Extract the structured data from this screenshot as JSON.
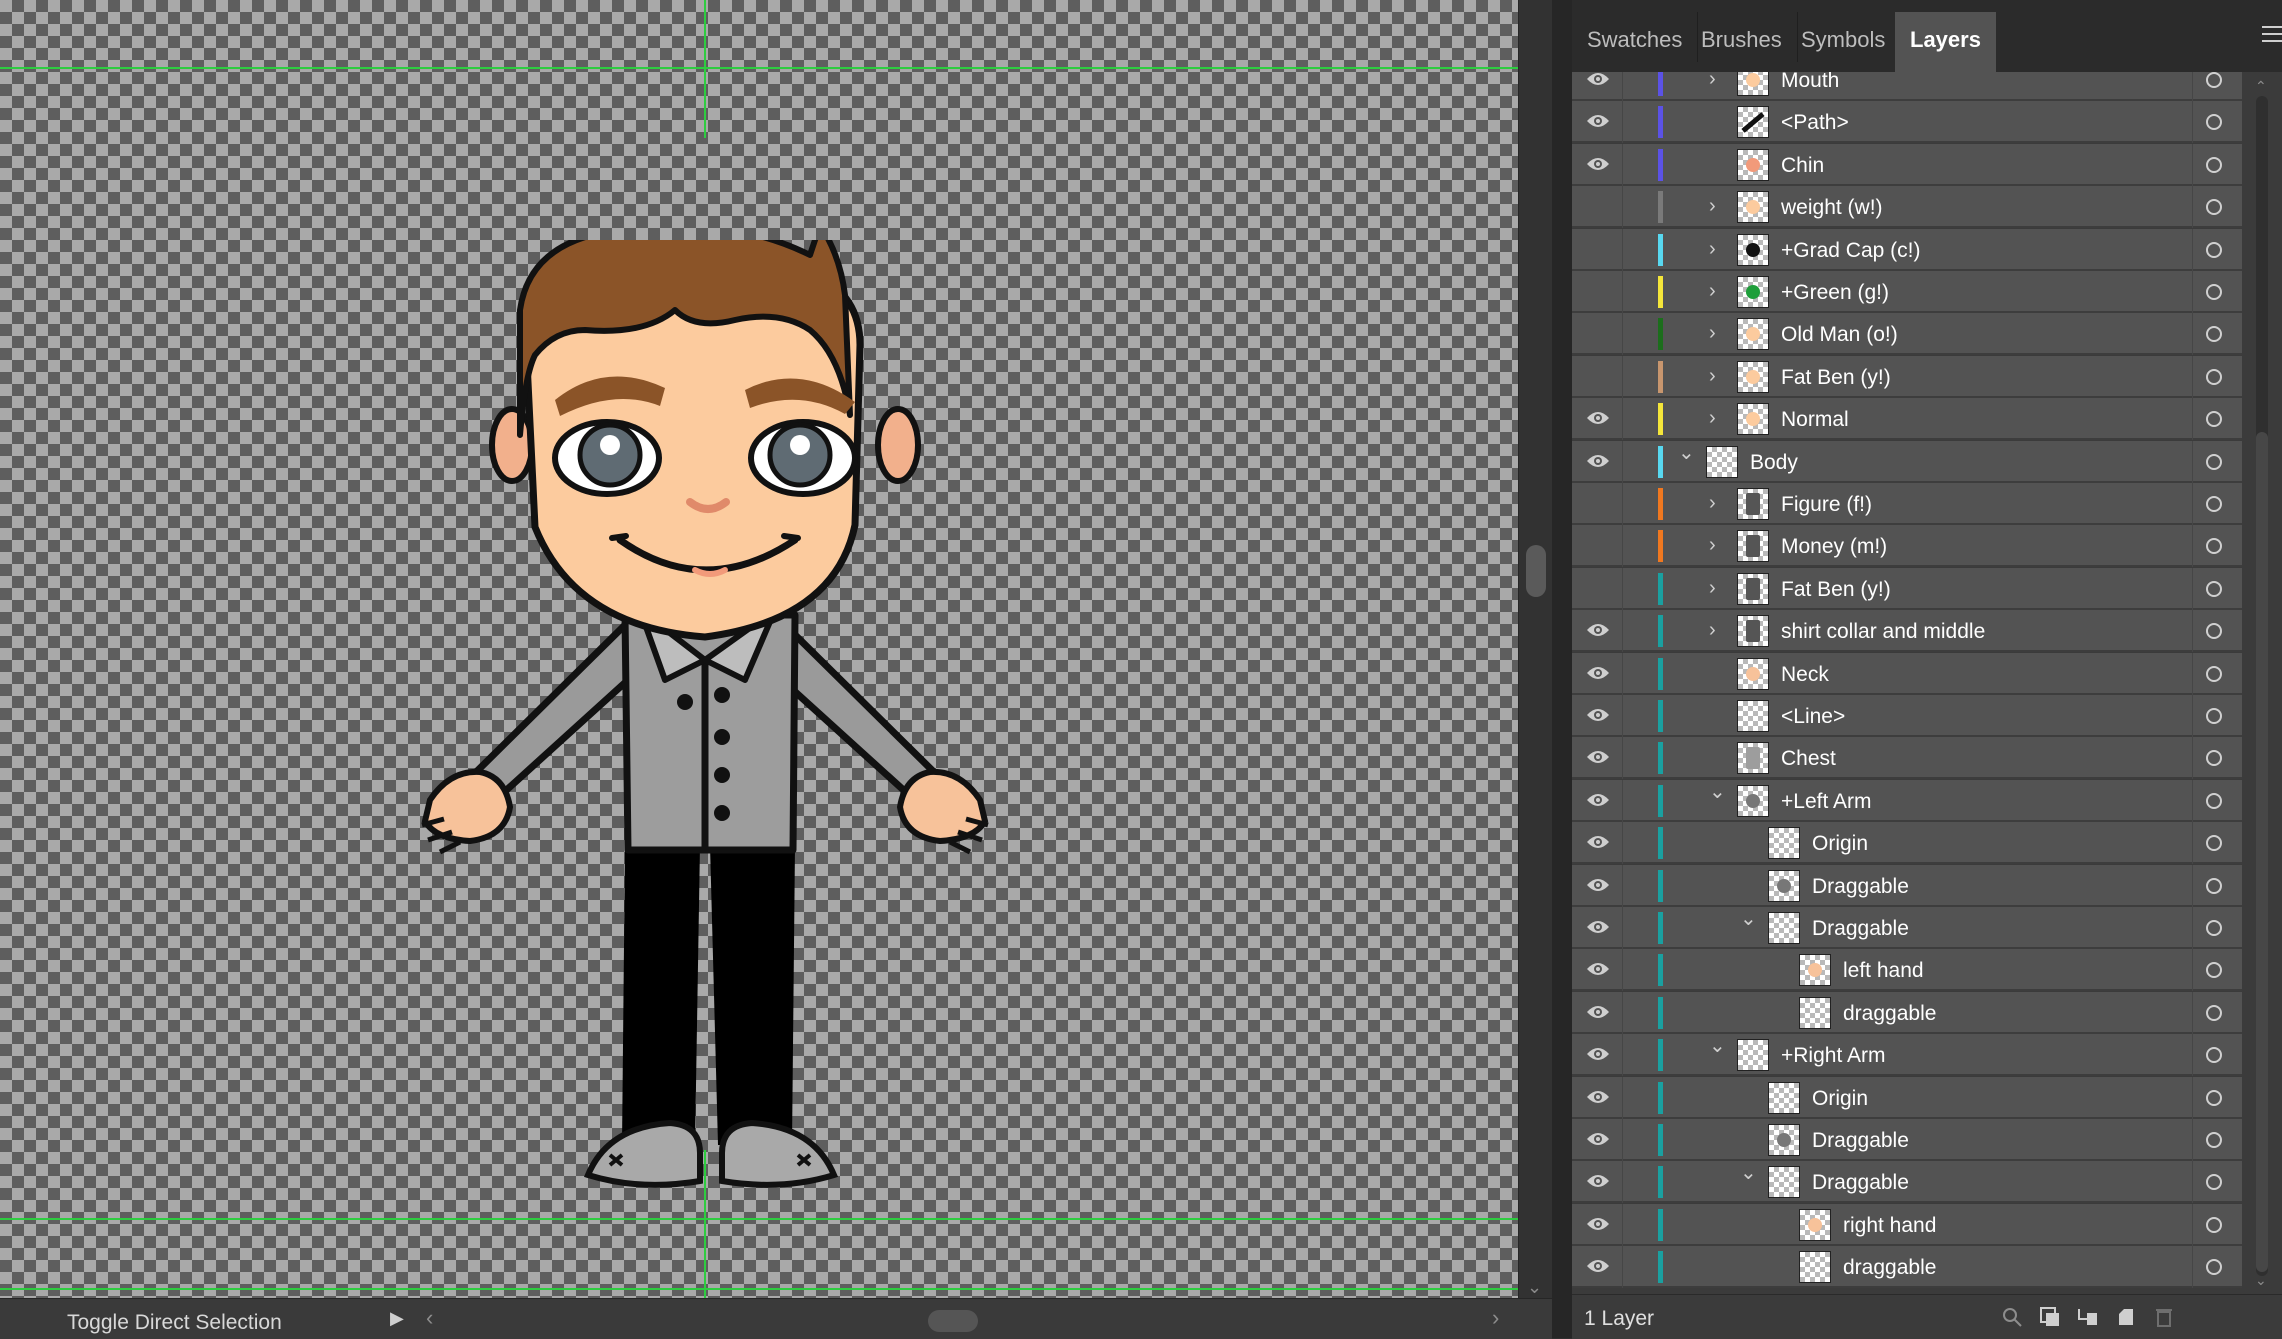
{
  "status_bar": {
    "text": "Toggle Direct Selection"
  },
  "panel": {
    "tabs": [
      {
        "label": "Swatches",
        "active": false
      },
      {
        "label": "Brushes",
        "active": false
      },
      {
        "label": "Symbols",
        "active": false
      },
      {
        "label": "Layers",
        "active": true
      }
    ],
    "footer": {
      "layer_count": "1 Layer"
    },
    "rows": [
      {
        "label": "Mouth",
        "visible": true,
        "color": "#5b52e6",
        "arrow": "right",
        "thumb": "face"
      },
      {
        "label": "<Path>",
        "visible": true,
        "color": "#5b52e6",
        "arrow": "none",
        "thumb": "path"
      },
      {
        "label": "Chin",
        "visible": true,
        "color": "#5b52e6",
        "arrow": "none",
        "thumb": "chin"
      },
      {
        "label": "weight (w!)",
        "visible": false,
        "color": "#7a7a7a",
        "arrow": "right",
        "thumb": "face"
      },
      {
        "label": "+Grad Cap (c!)",
        "visible": false,
        "color": "#58d8f0",
        "arrow": "right",
        "thumb": "cap"
      },
      {
        "label": "+Green (g!)",
        "visible": false,
        "color": "#f5e63a",
        "arrow": "right",
        "thumb": "green"
      },
      {
        "label": "Old Man (o!)",
        "visible": false,
        "color": "#1c6e1c",
        "arrow": "right",
        "thumb": "face"
      },
      {
        "label": "Fat Ben (y!)",
        "visible": false,
        "color": "#c8966e",
        "arrow": "right",
        "thumb": "face"
      },
      {
        "label": "Normal",
        "visible": true,
        "color": "#f5e63a",
        "arrow": "right",
        "thumb": "face"
      },
      {
        "label": "Body",
        "visible": true,
        "color": "#58d8f0",
        "arrow": "down",
        "thumb": "checker"
      },
      {
        "label": "Figure (f!)",
        "visible": false,
        "color": "#f07820",
        "arrow": "right",
        "thumb": "figure"
      },
      {
        "label": "Money (m!)",
        "visible": false,
        "color": "#f07820",
        "arrow": "right",
        "thumb": "figure"
      },
      {
        "label": "Fat Ben (y!)",
        "visible": false,
        "color": "#1aa0a0",
        "arrow": "right",
        "thumb": "figure"
      },
      {
        "label": "shirt collar and middle",
        "visible": true,
        "color": "#1aa0a0",
        "arrow": "right",
        "thumb": "figure"
      },
      {
        "label": "Neck",
        "visible": true,
        "color": "#1aa0a0",
        "arrow": "none",
        "thumb": "neck"
      },
      {
        "label": "<Line>",
        "visible": true,
        "color": "#1aa0a0",
        "arrow": "none",
        "thumb": "checker"
      },
      {
        "label": "Chest",
        "visible": true,
        "color": "#1aa0a0",
        "arrow": "none",
        "thumb": "chest"
      },
      {
        "label": "+Left Arm",
        "visible": true,
        "color": "#1aa0a0",
        "arrow": "down",
        "thumb": "arm"
      },
      {
        "label": "Origin",
        "visible": true,
        "color": "#1aa0a0",
        "arrow": "none",
        "thumb": "checker"
      },
      {
        "label": "Draggable",
        "visible": true,
        "color": "#1aa0a0",
        "arrow": "none",
        "thumb": "arm"
      },
      {
        "label": "Draggable",
        "visible": true,
        "color": "#1aa0a0",
        "arrow": "down",
        "thumb": "checker"
      },
      {
        "label": "left hand",
        "visible": true,
        "color": "#1aa0a0",
        "arrow": "none",
        "thumb": "hand"
      },
      {
        "label": "draggable",
        "visible": true,
        "color": "#1aa0a0",
        "arrow": "none",
        "thumb": "checker"
      },
      {
        "label": "+Right Arm",
        "visible": true,
        "color": "#1aa0a0",
        "arrow": "down",
        "thumb": "checker"
      },
      {
        "label": "Origin",
        "visible": true,
        "color": "#1aa0a0",
        "arrow": "none",
        "thumb": "checker"
      },
      {
        "label": "Draggable",
        "visible": true,
        "color": "#1aa0a0",
        "arrow": "none",
        "thumb": "arm"
      },
      {
        "label": "Draggable",
        "visible": true,
        "color": "#1aa0a0",
        "arrow": "down",
        "thumb": "checker"
      },
      {
        "label": "right hand",
        "visible": true,
        "color": "#1aa0a0",
        "arrow": "none",
        "thumb": "hand"
      },
      {
        "label": "draggable",
        "visible": true,
        "color": "#1aa0a0",
        "arrow": "none",
        "thumb": "checker"
      }
    ]
  }
}
